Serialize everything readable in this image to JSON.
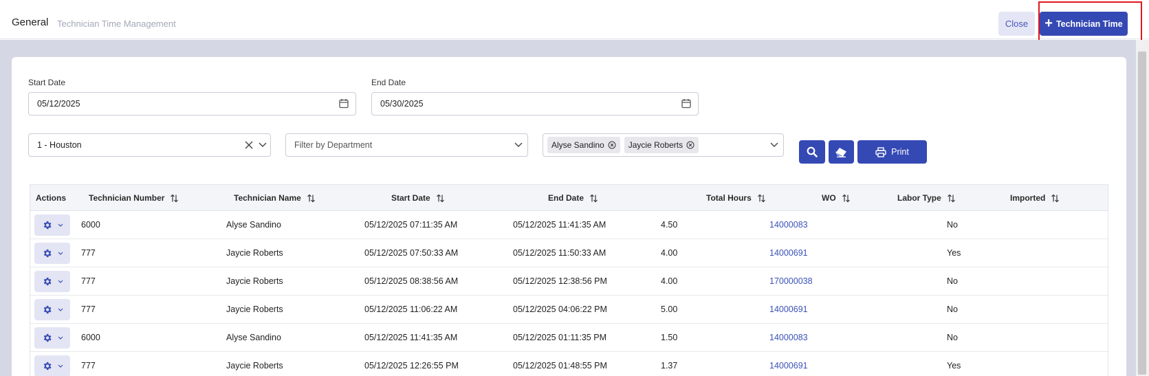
{
  "header": {
    "title": "General",
    "subtitle": "Technician Time Management",
    "close_label": "Close",
    "add_label": "Technician Time"
  },
  "filters": {
    "start_date_label": "Start Date",
    "start_date_value": "05/12/2025",
    "end_date_label": "End Date",
    "end_date_value": "05/30/2025",
    "location_value": "1 - Houston",
    "department_placeholder": "Filter by Department",
    "technicians": [
      "Alyse Sandino",
      "Jaycie Roberts"
    ],
    "print_label": "Print"
  },
  "table": {
    "columns": [
      "Actions",
      "Technician Number",
      "Technician Name",
      "Start Date",
      "End Date",
      "Total Hours",
      "WO",
      "Labor Type",
      "Imported"
    ],
    "rows": [
      {
        "number": "6000",
        "name": "Alyse Sandino",
        "start": "05/12/2025 07:11:35 AM",
        "end": "05/12/2025 11:41:35 AM",
        "hours": "4.50",
        "wo": "14000083",
        "labor": "",
        "imported": "No"
      },
      {
        "number": "777",
        "name": "Jaycie Roberts",
        "start": "05/12/2025 07:50:33 AM",
        "end": "05/12/2025 11:50:33 AM",
        "hours": "4.00",
        "wo": "14000691",
        "labor": "",
        "imported": "Yes"
      },
      {
        "number": "777",
        "name": "Jaycie Roberts",
        "start": "05/12/2025 08:38:56 AM",
        "end": "05/12/2025 12:38:56 PM",
        "hours": "4.00",
        "wo": "170000038",
        "labor": "",
        "imported": "No"
      },
      {
        "number": "777",
        "name": "Jaycie Roberts",
        "start": "05/12/2025 11:06:22 AM",
        "end": "05/12/2025 04:06:22 PM",
        "hours": "5.00",
        "wo": "14000691",
        "labor": "",
        "imported": "No"
      },
      {
        "number": "6000",
        "name": "Alyse Sandino",
        "start": "05/12/2025 11:41:35 AM",
        "end": "05/12/2025 01:11:35 PM",
        "hours": "1.50",
        "wo": "14000083",
        "labor": "",
        "imported": "No"
      },
      {
        "number": "777",
        "name": "Jaycie Roberts",
        "start": "05/12/2025 12:26:55 PM",
        "end": "05/12/2025 01:48:55 PM",
        "hours": "1.37",
        "wo": "14000691",
        "labor": "",
        "imported": "Yes"
      }
    ]
  },
  "colors": {
    "primary": "#3549b4",
    "link": "#3a52b8",
    "background": "#d6d7e4",
    "highlight": "#e0171c"
  },
  "icons": {
    "calendar": "calendar-icon",
    "clear": "close-icon",
    "chevron": "chevron-down-icon",
    "search": "search-icon",
    "eraser": "eraser-icon",
    "print": "printer-icon",
    "sort": "sort-icon",
    "gear": "gear-icon",
    "plus": "plus-icon"
  }
}
